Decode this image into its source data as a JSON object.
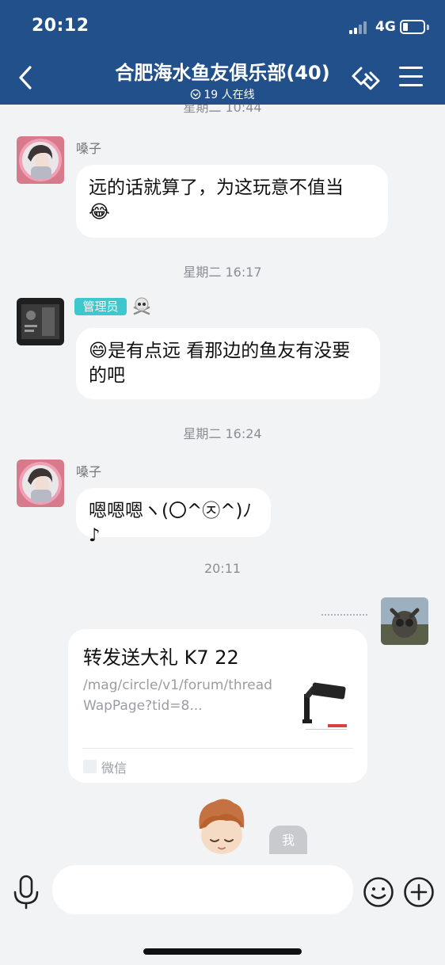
{
  "status_bar": {
    "time": "20:12",
    "network": "4G",
    "battery_level": 0.2
  },
  "header": {
    "title": "合肥海水鱼友俱乐部(40)",
    "online_text": "19 人在线",
    "back_icon": "chevron-left-icon",
    "share_icon": "link-share-icon",
    "menu_icon": "hamburger-menu-icon"
  },
  "messages": [
    {
      "type": "timestamp",
      "text": "星期二 10:44"
    },
    {
      "type": "message",
      "sender": "嗓子",
      "text": "远的话就算了，为这玩意不值当",
      "emoji": "😂"
    },
    {
      "type": "timestamp",
      "text": "星期二 16:17"
    },
    {
      "type": "message",
      "badge": "管理员",
      "badge_color": "#3fc7ce",
      "emoji": "😄",
      "text": "是有点远 看那边的鱼友有没要的吧"
    },
    {
      "type": "timestamp",
      "text": "星期二 16:24"
    },
    {
      "type": "message",
      "sender": "嗓子",
      "text": "嗯嗯嗯ヽ(〇^㉨^)ﾉ♪"
    },
    {
      "type": "timestamp",
      "text": "20:11"
    },
    {
      "type": "card",
      "title": "转发送大礼 K7 22",
      "desc": "/mag/circle/v1/forum/threadWapPage?tid=8...",
      "source": "微信"
    },
    {
      "type": "sticker",
      "tag": "我"
    }
  ],
  "input": {
    "placeholder": "",
    "value": ""
  },
  "colors": {
    "header_bg": "#22508a",
    "page_bg": "#f2f3f5",
    "badge": "#3fc7ce"
  }
}
